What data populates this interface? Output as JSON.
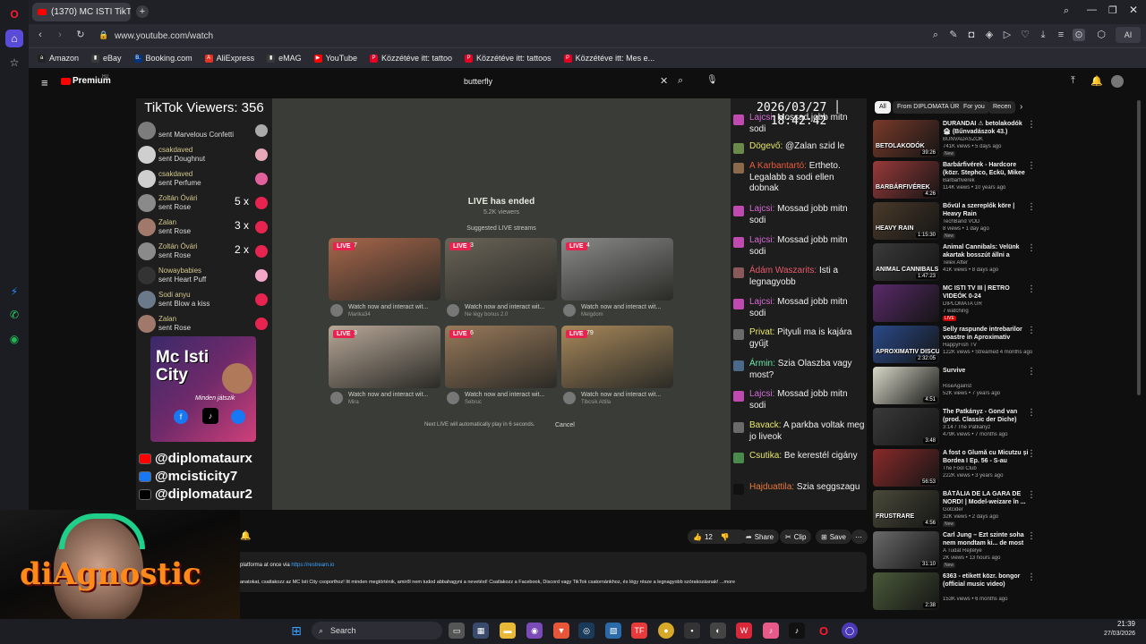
{
  "browser": {
    "tab_title": "(1370) MC ISTI TikTok Mi...",
    "url": "www.youtube.com/watch",
    "ai_label": "AI"
  },
  "bookmarks": [
    {
      "label": "Amazon",
      "color": "#222",
      "glyph": "a"
    },
    {
      "label": "eBay",
      "color": "#3a3a3a",
      "glyph": "▮"
    },
    {
      "label": "Booking.com",
      "color": "#003580",
      "glyph": "B."
    },
    {
      "label": "AliExpress",
      "color": "#e43225",
      "glyph": "A"
    },
    {
      "label": "eMAG",
      "color": "#3a3a3a",
      "glyph": "▮"
    },
    {
      "label": "YouTube",
      "color": "#ff0000",
      "glyph": "▶"
    },
    {
      "label": "Közzétéve itt: tattoo",
      "color": "#e60023",
      "glyph": "P"
    },
    {
      "label": "Közzétéve itt: tattoos",
      "color": "#e60023",
      "glyph": "P"
    },
    {
      "label": "Közzétéve itt: Mes e...",
      "color": "#e60023",
      "glyph": "P"
    }
  ],
  "youtube": {
    "logo": "Premium",
    "logo_sup": "HU",
    "search_value": "butterfly"
  },
  "overlay": {
    "viewers": "TikTok Viewers: 356",
    "gifts": [
      {
        "name": "",
        "text": "sent Marvelous Confetti",
        "count": "",
        "gift_color": "#aaaaaa",
        "avatar": "#7c7c7c"
      },
      {
        "name": "csakdaved",
        "text": "sent Doughnut",
        "count": "",
        "gift_color": "#e7a7b7",
        "avatar": "#cfcfcf"
      },
      {
        "name": "csakdaved",
        "text": "sent Perfume",
        "count": "",
        "gift_color": "#e3619a",
        "avatar": "#cfcfcf"
      },
      {
        "name": "Zoltán Óvári",
        "text": "sent Rose",
        "count": "5 x",
        "gift_color": "#e7234f",
        "avatar": "#8a8a8a"
      },
      {
        "name": "Zalan",
        "text": "sent Rose",
        "count": "3 x",
        "gift_color": "#e7234f",
        "avatar": "#a0796a"
      },
      {
        "name": "Zoltán Óvári",
        "text": "sent Rose",
        "count": "2 x",
        "gift_color": "#e7234f",
        "avatar": "#8a8a8a"
      },
      {
        "name": "Nowaybabies",
        "text": "sent Heart Puff",
        "count": "",
        "gift_color": "#f3a7c7",
        "avatar": "#333"
      },
      {
        "name": "Sodi anyu",
        "text": "sent Blow a kiss",
        "count": "",
        "gift_color": "#e7234f",
        "avatar": "#6a7a8a"
      },
      {
        "name": "Zalan",
        "text": "sent Rose",
        "count": "",
        "gift_color": "#e7234f",
        "avatar": "#a0796a"
      }
    ],
    "promo_title": "Mc Isti City",
    "promo_sub": "Minden játszik",
    "socials": [
      {
        "handle": "@diplomataurx",
        "color": "#ff0000"
      },
      {
        "handle": "@mcisticity7",
        "color": "#1877f2"
      },
      {
        "handle": "@diplomataur2",
        "color": "#000000"
      }
    ],
    "datetime": "2026/03/27 │ 18:42:42"
  },
  "stream": {
    "ended_title": "LIVE has ended",
    "ended_views": "5.2K viewers",
    "suggested_heading": "Suggested LIVE streams",
    "cards": [
      {
        "live": "LIVE",
        "viewers": "7",
        "text": "Watch now and interact wit...",
        "user": "Marika34",
        "tone": "#a8664a"
      },
      {
        "live": "LIVE",
        "viewers": "3",
        "text": "Watch now and interact wit...",
        "user": "Ne légy bonus 2.0",
        "tone": "#6a6458"
      },
      {
        "live": "LIVE",
        "viewers": "4",
        "text": "Watch now and interact wit...",
        "user": "Melgdom",
        "tone": "#8a8a8a"
      },
      {
        "live": "LIVE",
        "viewers": "3",
        "text": "Watch now and interact wit...",
        "user": "Mira",
        "tone": "#b8a898"
      },
      {
        "live": "LIVE",
        "viewers": "6",
        "text": "Watch now and interact wit...",
        "user": "Sebruc",
        "tone": "#9a7a5a"
      },
      {
        "live": "LIVE",
        "viewers": "79",
        "text": "Watch now and interact wit...",
        "user": "Tibcsik Attila",
        "tone": "#a8885a"
      }
    ],
    "autoplay_text": "Next LIVE will automatically play in 6 seconds.",
    "cancel": "Cancel"
  },
  "chat": [
    {
      "name": "Lajcsi:",
      "text": "Mossad jobb mitn sodi",
      "name_color": "#d46ad4",
      "avatar": "#c04ab0"
    },
    {
      "name": "Dögevő:",
      "text": "@Zalan szid le",
      "name_color": "#e8e86a",
      "avatar": "#6a8a4a"
    },
    {
      "name": "A Karbantartó:",
      "text": "Ertheto. Legalabb a sodi ellen dobnak",
      "name_color": "#e85a3a",
      "avatar": "#8a6a4a"
    },
    {
      "name": "Lajcsi:",
      "text": "Mossad jobb mitn sodi",
      "name_color": "#d46ad4",
      "avatar": "#c04ab0"
    },
    {
      "name": "Lajcsi:",
      "text": "Mossad jobb mitn sodi",
      "name_color": "#d46ad4",
      "avatar": "#c04ab0"
    },
    {
      "name": "Ádám Waszarits:",
      "text": "Isti a legnagyobb",
      "name_color": "#e85a6a",
      "avatar": "#8a5a5a"
    },
    {
      "name": "Lajcsi:",
      "text": "Mossad jobb mitn sodi",
      "name_color": "#d46ad4",
      "avatar": "#c04ab0"
    },
    {
      "name": "Privat:",
      "text": "Pityuli ma is kajára gyűjt",
      "name_color": "#e8e86a",
      "avatar": "#6a6a6a"
    },
    {
      "name": "Ármin:",
      "text": "Szia Olaszba vagy most?",
      "name_color": "#6ae8a8",
      "avatar": "#4a6a8a"
    },
    {
      "name": "Lajcsi:",
      "text": "Mossad jobb mitn sodi",
      "name_color": "#d46ad4",
      "avatar": "#c04ab0"
    },
    {
      "name": "Bavack:",
      "text": "A parkba voltak meg jo liveok",
      "name_color": "#e8e86a",
      "avatar": "#6a6a6a"
    },
    {
      "name": "Csutika:",
      "text": "Be kerestél cigány",
      "name_color": "#e8e86a",
      "avatar": "#4a8a4a"
    },
    {
      "name": "Hajduattila:",
      "text": "Szia seggszagu",
      "name_color": "#e87a3a",
      "avatar": "#111111"
    }
  ],
  "chips": [
    "All",
    "From DIPLOMATA ÚR",
    "For you",
    "Recen"
  ],
  "suggestions": [
    {
      "title": "DURANDAI ⚠ betolakodók 🏚 (Bűnvadászok 43.)",
      "channel": "BŰNVADÁSZOK",
      "meta": "741K views • 5 days ago",
      "badge": "New",
      "duration": "39:26",
      "tone": "#7a3a2a",
      "label": "BETOLAKODÓK"
    },
    {
      "title": "Barbárfivérek - Hardcore (közr. Stephco, Eckü, Mikee Mykanic,...",
      "channel": "Barbárfivérek",
      "meta": "114K views • 10 years ago",
      "badge": "",
      "duration": "4:26",
      "tone": "#9a3a3a",
      "label": "BARBÁRFIVÉREK"
    },
    {
      "title": "Bővül a szereplők köre | Heavy Rain",
      "channel": "TechBand VOD",
      "meta": "8 views • 1 day ago",
      "badge": "New",
      "duration": "1:15:30",
      "tone": "#4a3a2a",
      "label": "HEAVY RAIN"
    },
    {
      "title": "Animal Cannibals: Velünk akartak bosszút állni a Rapülő...",
      "channel": "Telex After",
      "meta": "41K views • 8 days ago",
      "badge": "",
      "duration": "1:47:23",
      "tone": "#3a3a3a",
      "label": "ANIMAL CANNIBALS"
    },
    {
      "title": "MC ISTI TV III | RETRO VIDEÓK 0-24",
      "channel": "DIPLOMATA ÚR",
      "meta": "7 watching",
      "badge": "LIVE",
      "duration": "",
      "tone": "#5a2a6a",
      "label": ""
    },
    {
      "title": "Selly raspunde intrebarilor voastre in Aproximativ Discutii...",
      "channel": "HappyFish TV",
      "meta": "122K views • Streamed 4 months ago",
      "badge": "",
      "duration": "2:32:05",
      "tone": "#2a4a8a",
      "label": "APROXIMATIV DISCUTII"
    },
    {
      "title": "Survive",
      "channel": "RiseAgainst",
      "meta": "52K views • 7 years ago",
      "badge": "",
      "duration": "4:51",
      "tone": "#d8d8c8",
      "label": ""
    },
    {
      "title": "The Patkányz - Gond van (prod. Classic der Diche)",
      "channel": "3:14 / The Patkányz",
      "meta": "479K views • 7 months ago",
      "badge": "",
      "duration": "3:48",
      "tone": "#3a3a3a",
      "label": ""
    },
    {
      "title": "A fost o Glumă cu Micutzu și Bordea I Ep. 56 - S-au despărțit...",
      "channel": "The Fool Club",
      "meta": "222K views • 3 years ago",
      "badge": "",
      "duration": "56:53",
      "tone": "#8a2a2a",
      "label": ""
    },
    {
      "title": "BĂTĂLIA DE LA GARA DE NORD! | Model-weizare în ...",
      "channel": "Gotcider",
      "meta": "32K views • 2 days ago",
      "badge": "New",
      "duration": "4:56",
      "tone": "#4a4a3a",
      "label": "FRUSTRARE"
    },
    {
      "title": "Carl Jung – Ezt szinte soha nem mondtam ki... de most ki kell ...",
      "channel": "A Tudat Rejtélye",
      "meta": "2K views • 13 hours ago",
      "badge": "New",
      "duration": "31:10",
      "tone": "#6a6a6a",
      "label": ""
    },
    {
      "title": "6363 - etikett közr. bongor (official music video)",
      "channel": "",
      "meta": "153K views • 6 months ago",
      "badge": "",
      "duration": "2:38",
      "tone": "#4a5a3a",
      "label": ""
    }
  ],
  "actions": {
    "likes": "12",
    "share": "Share",
    "clip": "Clip",
    "save": "Save"
  },
  "description": {
    "line1_text": "platforma at once via ",
    "line1_link": "https://restream.io",
    "line2": "anatokat, csatlakozz az MC Isti City csoporthoz! Itt minden megtörténik, amiről nem tudod abbahagyni a nevetést! Csatlakozz a Facebook, Discord vagy TikTok csatornánkhoz, és légy része a legnagyobb szórakozásnak! ...more"
  },
  "webcam": {
    "logo": "diAgnostic"
  },
  "taskbar": {
    "search_placeholder": "Search",
    "time": "21:39",
    "date": "27/03/2026"
  }
}
